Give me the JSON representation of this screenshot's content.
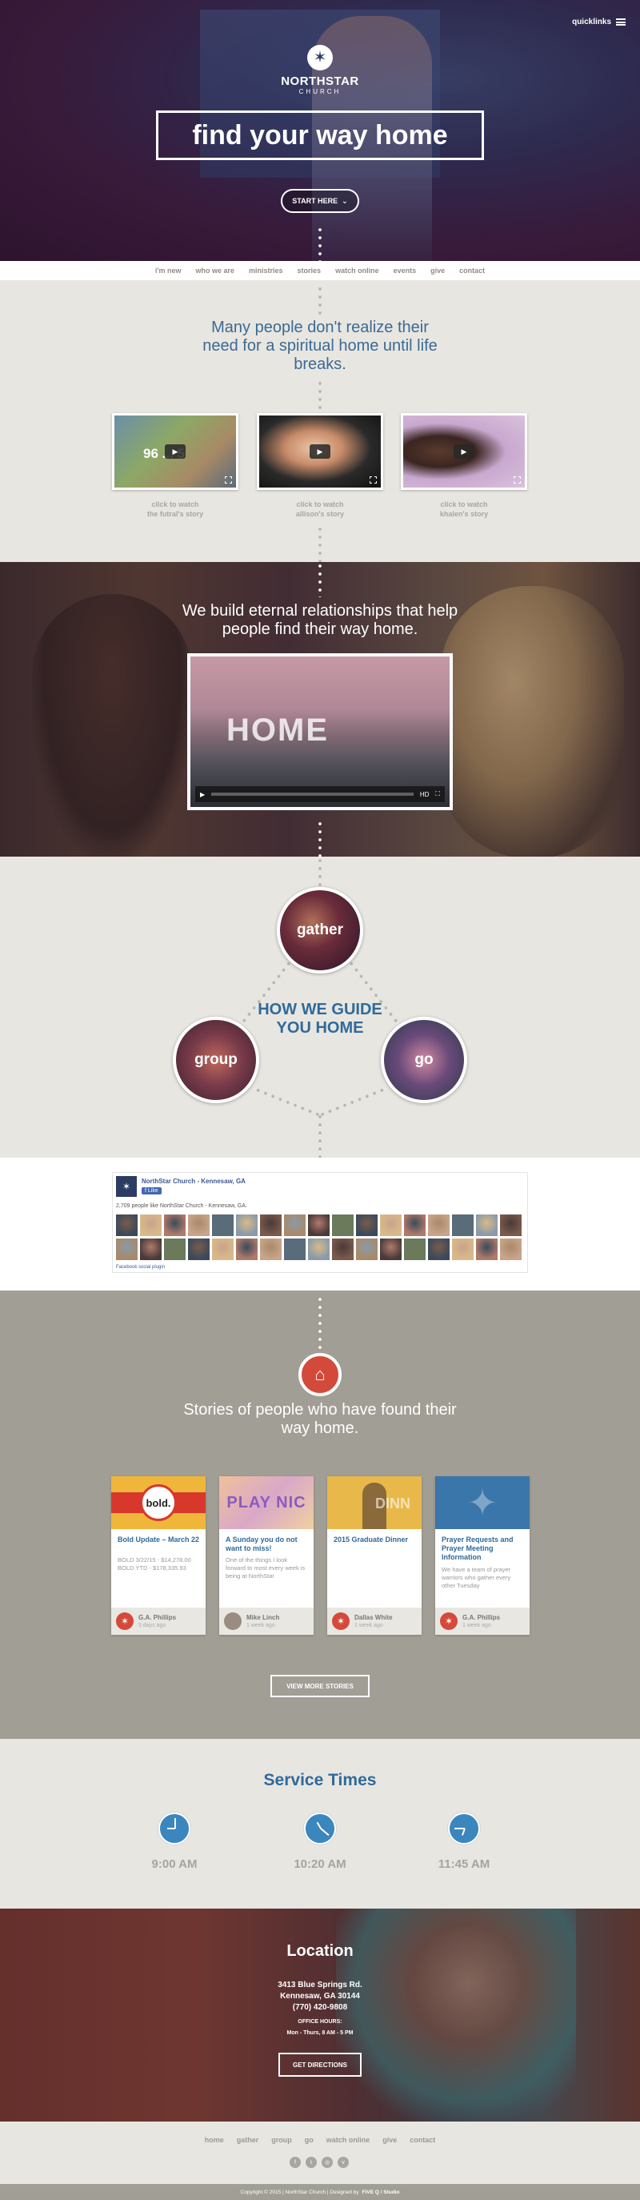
{
  "header": {
    "quicklinks_label": "quicklinks",
    "logo_name": "NORTHSTAR",
    "logo_sub": "CHURCH",
    "hero_title": "find your way home",
    "start_button": "START HERE"
  },
  "nav": {
    "items": [
      "i'm new",
      "who we are",
      "ministries",
      "stories",
      "watch online",
      "events",
      "give",
      "contact"
    ]
  },
  "intro": {
    "headline": "Many people don't realize their need for a spiritual home until life breaks.",
    "videos": [
      {
        "caption_line1": "click to watch",
        "caption_line2": "the futral's story",
        "overlay_text": "96 ... 5"
      },
      {
        "caption_line1": "click to watch",
        "caption_line2": "allison's story"
      },
      {
        "caption_line1": "click to watch",
        "caption_line2": "khalen's story"
      }
    ]
  },
  "mission": {
    "headline": "We build eternal relationships that help people find their way home.",
    "video_word": "HOME"
  },
  "guide": {
    "title": "HOW WE GUIDE YOU HOME",
    "gather": "gather",
    "group": "group",
    "go": "go"
  },
  "facebook": {
    "page_name": "NorthStar Church - Kennesaw, GA",
    "like_label": "Like",
    "count_text": "2,709 people like NorthStar Church - Kennesaw, GA.",
    "plugin_label": "Facebook social plugin"
  },
  "stories": {
    "headline": "Stories of people who have found their way home.",
    "cards": [
      {
        "title": "Bold Update – March 22",
        "body": "BOLD 3/22/15 - $14,278.00 BOLD YTD - $178,335.93",
        "author": "G.A. Phillips",
        "date": "5 days ago",
        "image_text": "bold."
      },
      {
        "title": "A Sunday you do not want to miss!",
        "body": "One of the things I look forward to most every week is being at NorthStar",
        "author": "Mike Linch",
        "date": "1 week ago",
        "image_text": "PLAY NIC"
      },
      {
        "title": "2015 Graduate Dinner",
        "body": "",
        "author": "Dallas White",
        "date": "1 week ago",
        "image_text": "DINN"
      },
      {
        "title": "Prayer Requests and Prayer Meeting Information",
        "body": "We have a team of prayer warriors who gather every other Tuesday",
        "author": "G.A. Phillips",
        "date": "1 week ago",
        "image_text": ""
      }
    ],
    "more_button": "VIEW MORE STORIES"
  },
  "service": {
    "title": "Service Times",
    "times": [
      "9:00 AM",
      "10:20 AM",
      "11:45 AM"
    ]
  },
  "location": {
    "title": "Location",
    "address1": "3413 Blue Springs Rd.",
    "address2": "Kennesaw, GA 30144",
    "phone": "(770) 420-9808",
    "office_label": "OFFICE HOURS:",
    "office_hours": "Mon - Thurs, 8 AM - 5 PM",
    "directions_button": "GET DIRECTIONS"
  },
  "footer": {
    "nav": [
      "home",
      "gather",
      "group",
      "go",
      "watch online",
      "give",
      "contact"
    ],
    "copyright": "Copyright © 2015 | NorthStar Church | Designed by",
    "designer": "FIVE Q / Studio"
  },
  "colors": {
    "accent_blue": "#2f6a9a",
    "red": "#d44a3a",
    "stone": "#a19e95",
    "light": "#e8e6e1"
  }
}
